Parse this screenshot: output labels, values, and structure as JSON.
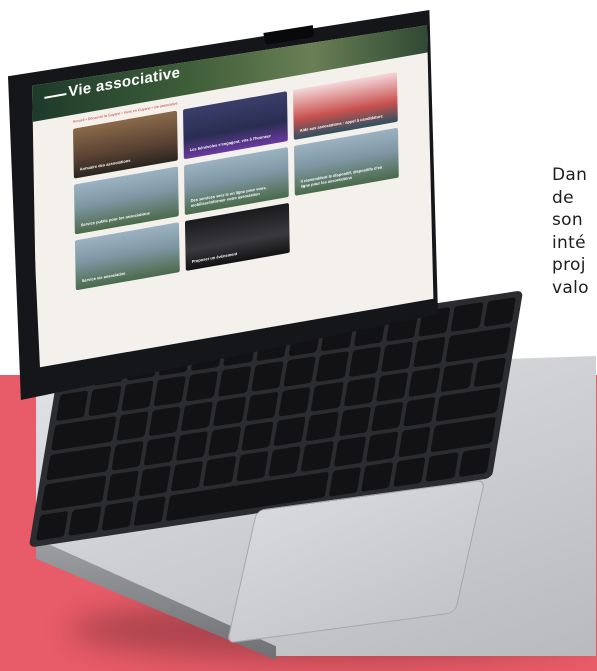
{
  "side_text": [
    "Dan",
    "de",
    "son",
    "inté",
    "proj",
    "valo"
  ],
  "screen": {
    "title": "Vie associative",
    "breadcrumb": "Accueil • Découvrir la Guyane • Vivre en Guyane • Vie associative",
    "cards": [
      {
        "label": "Annuaire des associations",
        "style": "brown"
      },
      {
        "label": "Les bénévoles s'engagent, vos à l'honneur",
        "style": "dark"
      },
      {
        "label": "Aide aux associations : appel à candidature",
        "style": "light"
      },
      {
        "label": "Service public pour les associations",
        "style": "sky"
      },
      {
        "label": "Des services vers le en ligne pour vous, mobiliser/informer votre association",
        "style": "sky"
      },
      {
        "label": "Il rassemblent le dispositif, dispositifs d'en ligne pour les associations",
        "style": "sky"
      },
      {
        "label": "Service vie associative",
        "style": "sky"
      },
      {
        "label": "Proposer un événement",
        "style": "laptopimg"
      }
    ]
  },
  "colors": {
    "accent_band": "#e85b68",
    "breadcrumb": "#c0392b"
  }
}
